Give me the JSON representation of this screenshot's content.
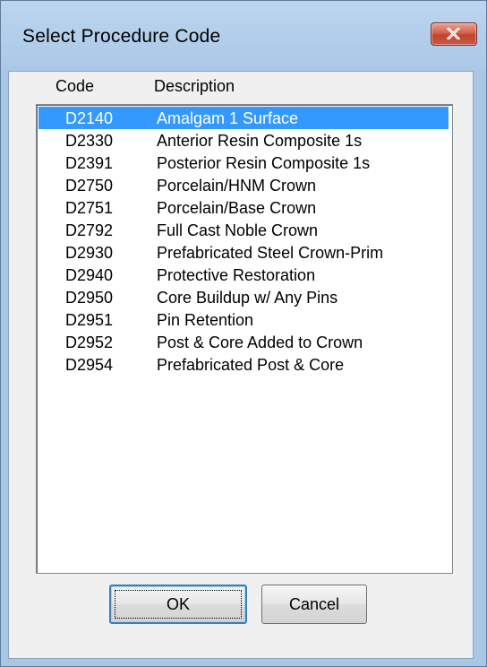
{
  "window": {
    "title": "Select Procedure Code"
  },
  "columns": {
    "code": "Code",
    "description": "Description"
  },
  "procedures": [
    {
      "code": "D2140",
      "description": "Amalgam 1 Surface",
      "selected": true
    },
    {
      "code": "D2330",
      "description": "Anterior Resin Composite 1s",
      "selected": false
    },
    {
      "code": "D2391",
      "description": "Posterior Resin Composite 1s",
      "selected": false
    },
    {
      "code": "D2750",
      "description": "Porcelain/HNM Crown",
      "selected": false
    },
    {
      "code": "D2751",
      "description": "Porcelain/Base Crown",
      "selected": false
    },
    {
      "code": "D2792",
      "description": "Full Cast Noble Crown",
      "selected": false
    },
    {
      "code": "D2930",
      "description": "Prefabricated Steel Crown-Prim",
      "selected": false
    },
    {
      "code": "D2940",
      "description": "Protective Restoration",
      "selected": false
    },
    {
      "code": "D2950",
      "description": "Core Buildup w/ Any Pins",
      "selected": false
    },
    {
      "code": "D2951",
      "description": "Pin Retention",
      "selected": false
    },
    {
      "code": "D2952",
      "description": "Post & Core Added to Crown",
      "selected": false
    },
    {
      "code": "D2954",
      "description": "Prefabricated Post & Core",
      "selected": false
    }
  ],
  "buttons": {
    "ok": "OK",
    "cancel": "Cancel"
  },
  "icons": {
    "close": "close-icon"
  },
  "colors": {
    "selection": "#3399ff",
    "titlebar": "#abc8e6",
    "close_button": "#c95a46"
  }
}
